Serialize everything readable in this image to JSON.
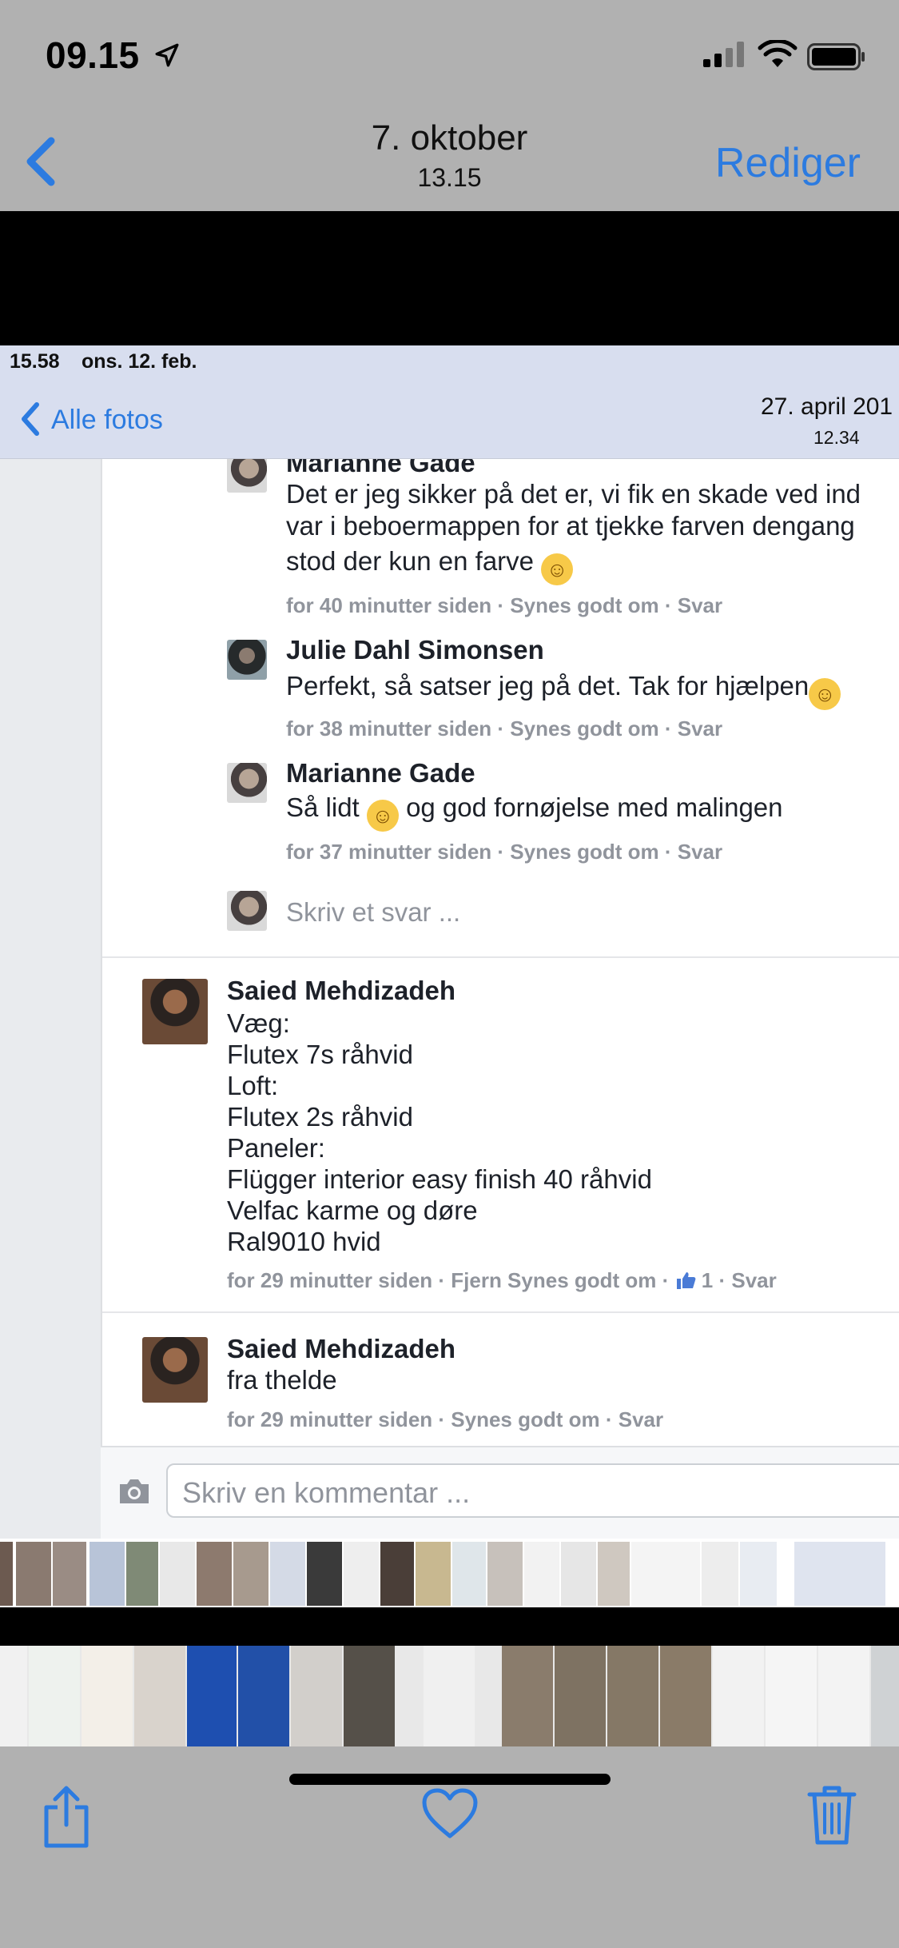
{
  "status_bar": {
    "time": "09.15"
  },
  "nav": {
    "title": "7. oktober",
    "subtitle": "13.15",
    "edit_label": "Rediger"
  },
  "inner": {
    "status": {
      "time": "15.58",
      "date": "ons. 12. feb."
    },
    "nav": {
      "back_label": "Alle fotos",
      "date": "27. april 201",
      "time": "12.34"
    },
    "replies": [
      {
        "name": "Marianne Gade",
        "lines": [
          "Det er jeg sikker på det er, vi fik en skade ved ind",
          "var i beboermappen for at tjekke farven dengang",
          "stod der kun en farve"
        ],
        "meta": "for 40 minutter siden · Synes godt om · Svar"
      },
      {
        "name": "Julie Dahl Simonsen",
        "lines": [
          "Perfekt, så satser jeg på det. Tak for hjælpen"
        ],
        "meta": "for 38 minutter siden · Synes godt om · Svar"
      },
      {
        "name": "Marianne Gade",
        "line_before": "Så lidt",
        "line_after": "og god fornøjelse med malingen",
        "meta": "for 37 minutter siden · Synes godt om · Svar"
      }
    ],
    "reply_placeholder": "Skriv et svar ...",
    "comments": [
      {
        "name": "Saied Mehdizadeh",
        "lines": [
          "Væg:",
          "Flutex 7s råhvid",
          "Loft:",
          "Flutex 2s råhvid",
          "Paneler:",
          "Flügger interior easy finish 40 råhvid",
          "Velfac karme og døre",
          "Ral9010 hvid"
        ],
        "meta_before": "for 29 minutter siden · Fjern Synes godt om ·",
        "likes": "1",
        "meta_after": "· Svar"
      },
      {
        "name": "Saied Mehdizadeh",
        "lines": [
          "fra thelde"
        ],
        "meta": "for 29 minutter siden · Synes godt om · Svar"
      }
    ],
    "comment_placeholder": "Skriv en kommentar ..."
  },
  "colors": {
    "accent": "#2c7be0",
    "chrome_bg": "#b1b1b1",
    "inner_nav_bg": "#d8deef",
    "meta_gray": "#90949c"
  },
  "icons": [
    "location-arrow-icon",
    "cellular-signal-icon",
    "wifi-icon",
    "battery-icon",
    "back-chevron-icon",
    "camera-icon",
    "thumbs-up-icon",
    "share-icon",
    "heart-icon",
    "trash-icon",
    "smiley-emoji-icon"
  ]
}
